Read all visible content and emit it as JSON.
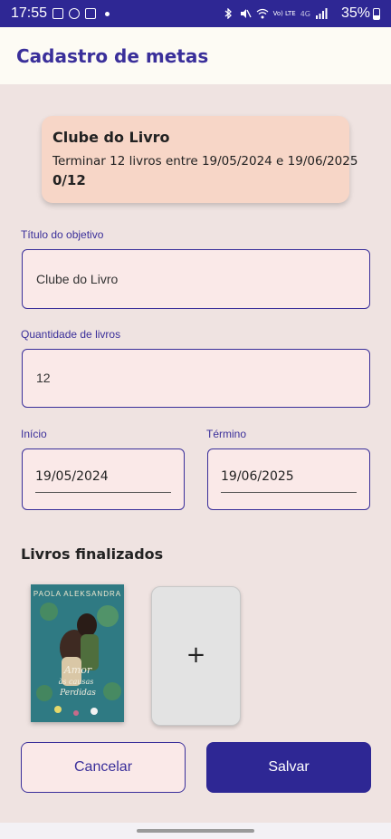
{
  "status_bar": {
    "time": "17:55",
    "battery_percent": "35%",
    "network": "4G",
    "volte": "Vo) LTE",
    "icons": [
      "gallery-icon",
      "whatsapp-icon",
      "calendar-icon",
      "dot-icon",
      "bluetooth-icon",
      "mute-icon",
      "wifi-icon",
      "signal-icon",
      "battery-icon"
    ]
  },
  "app_bar": {
    "title": "Cadastro de metas"
  },
  "summary_card": {
    "title": "Clube do Livro",
    "description": "Terminar 12 livros entre 19/05/2024 e 19/06/2025",
    "progress": "0/12"
  },
  "form": {
    "title_field": {
      "label": "Título do objetivo",
      "value": "Clube do Livro"
    },
    "quantity_field": {
      "label": "Quantidade de livros",
      "value": "12"
    },
    "start_field": {
      "label": "Início",
      "value": "19/05/2024"
    },
    "end_field": {
      "label": "Término",
      "value": "19/06/2025"
    }
  },
  "books": {
    "section_title": "Livros finalizados",
    "items": [
      {
        "cover_author": "PAOLA ALEKSANDRA",
        "cover_title": "Amor às causas perdidas"
      }
    ],
    "add_label": "+"
  },
  "actions": {
    "cancel_label": "Cancelar",
    "save_label": "Salvar"
  },
  "colors": {
    "primary": "#2e2794",
    "accent_text": "#3a2f9a",
    "background": "#efe3e1",
    "card": "#f7d6c7",
    "field_bg": "#fae9e8"
  }
}
